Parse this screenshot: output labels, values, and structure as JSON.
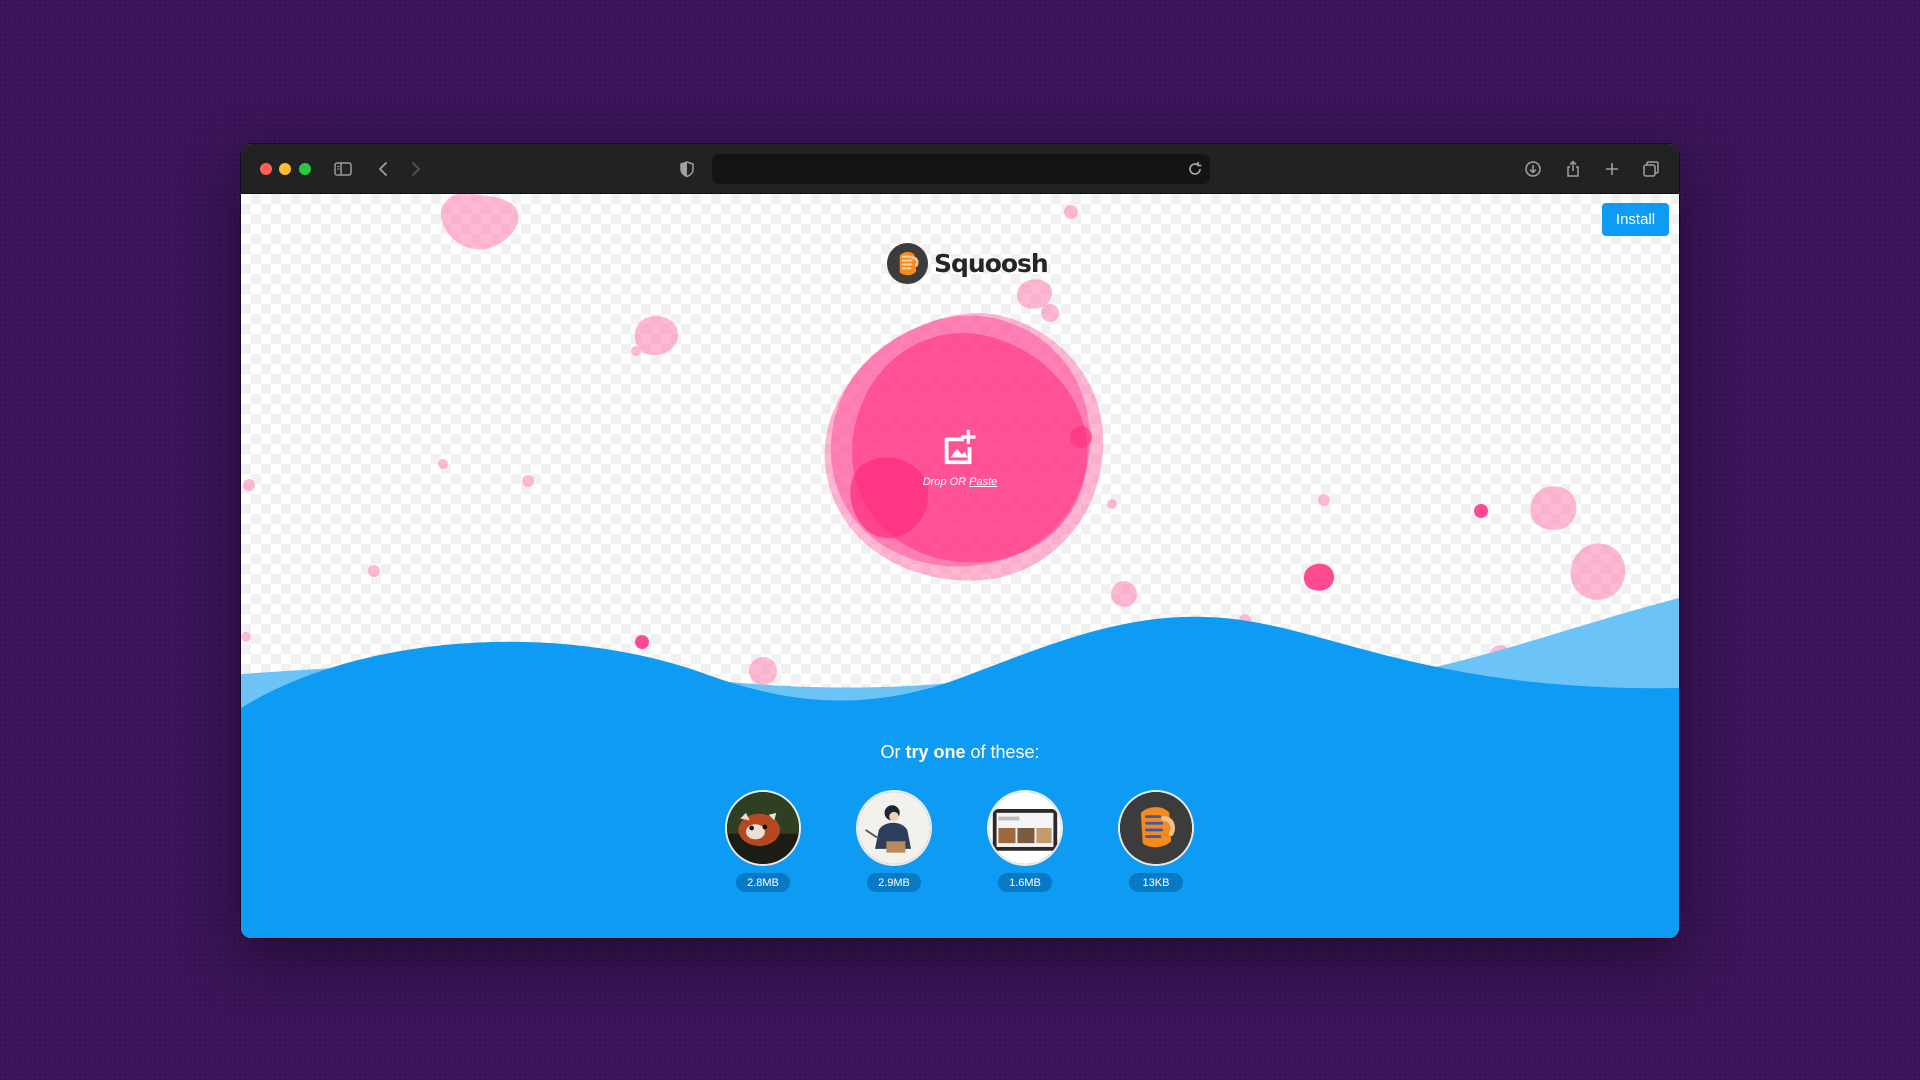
{
  "browser": {
    "url": "",
    "icons": [
      "sidebar-icon",
      "back-icon",
      "forward-icon",
      "shield-icon",
      "reload-icon",
      "download-icon",
      "share-icon",
      "new-tab-icon",
      "tabs-overview-icon"
    ]
  },
  "header": {
    "install_label": "Install",
    "logo_text": "Squoosh"
  },
  "drop_zone": {
    "drop_or_label": "Drop OR",
    "paste_label": "Paste",
    "icon": "add-image-icon"
  },
  "demos": {
    "heading_prefix": "Or",
    "heading_bold": "try one",
    "heading_suffix": "of these:",
    "items": [
      {
        "name": "red-panda",
        "size": "2.8MB"
      },
      {
        "name": "artwork",
        "size": "2.9MB"
      },
      {
        "name": "device-screen",
        "size": "1.6MB"
      },
      {
        "name": "squoosh-logo",
        "size": "13KB"
      }
    ]
  },
  "colors": {
    "accent": "#0d9bf3",
    "blob": "#ff3385",
    "wave": "#0d9bf3",
    "wave_back": "#6cc3f8"
  }
}
